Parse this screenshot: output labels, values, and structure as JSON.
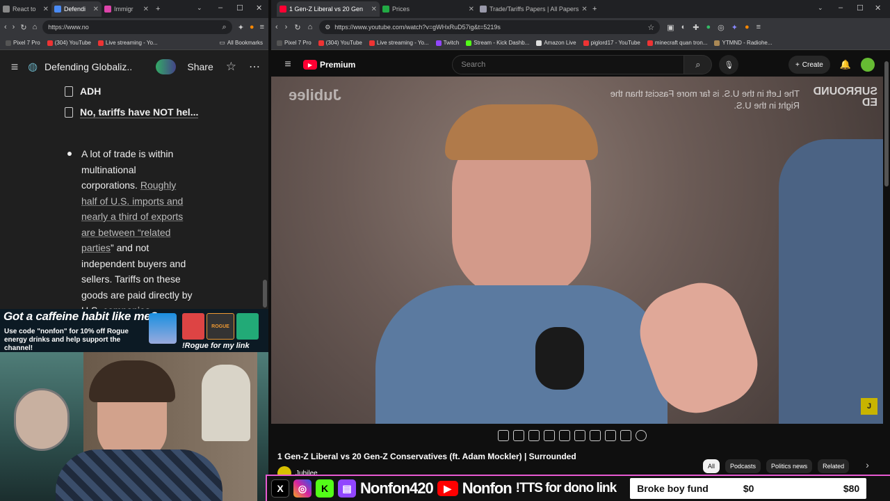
{
  "left_browser": {
    "tabs": [
      {
        "label": "React to",
        "active": false
      },
      {
        "label": "Defendi",
        "active": true
      },
      {
        "label": "Immigr",
        "active": false
      }
    ],
    "url": "https://www.no",
    "bookmarks": [
      "Pixel 7 Pro",
      "(304) YouTube",
      "Live streaming - Yo..."
    ],
    "all_bookmarks": "All Bookmarks"
  },
  "doc": {
    "title": "Defending Globaliz...",
    "share_label": "Share",
    "subpages": [
      "ADH",
      "No, tariffs have NOT hel..."
    ],
    "bullet_plain_1": "A lot of trade is within multinational corporations.",
    "bullet_link": "Roughly half of U.S. imports and nearly a third of exports are between “related parties",
    "bullet_plain_2": "” and not independent buyers and sellers. Tariffs on these goods are paid directly by U.S. companies"
  },
  "promo": {
    "headline": "Got a caffeine habit like me?",
    "subtext": "Use code \"nonfon\" for 10% off Rogue energy drinks and help support the channel!",
    "command": "!Rogue for my link",
    "brand": "ROGUE"
  },
  "right_browser": {
    "tabs": [
      {
        "label": "1 Gen-Z Liberal vs 20 Gen",
        "active": true
      },
      {
        "label": "Prices",
        "active": false
      },
      {
        "label": "Trade/Tariffs Papers | All Papers",
        "active": false
      }
    ],
    "url": "https://www.youtube.com/watch?v=gWHxRuD57ig&t=5219s",
    "bookmarks": [
      "Pixel 7 Pro",
      "(304) YouTube",
      "Live streaming - Yo...",
      "Twitch",
      "Stream - Kick Dashb...",
      "Amazon Live",
      "piglord17 - YouTube",
      "minecraft quan tron...",
      "YTMND - Radiohe..."
    ],
    "all_bookmarks": "All Bookmarks"
  },
  "youtube": {
    "logo_label": "Premium",
    "search_placeholder": "Search",
    "create_label": "Create",
    "video_title": "1 Gen-Z Liberal vs 20 Gen-Z Conservatives (ft. Adam Mockler) | Surrounded",
    "channel_name": "Jubilee",
    "watermark": "Jubilee",
    "overlay_quote": "The Left in the U.S. is far more Fascist than the Right in the U.S.",
    "show_logo": "SURROUNDED",
    "chips": [
      "All",
      "Podcasts",
      "Politics news",
      "Related"
    ]
  },
  "stream_overlay": {
    "handle_1": "Nonfon420",
    "handle_2": "Nonfon",
    "tts": "!TTS for dono link",
    "fund_label": "Broke boy fund",
    "fund_current": "$0",
    "fund_goal": "$80",
    "fund_progress": 0
  },
  "colors": {
    "accent_pink": "#e85ad2",
    "youtube_red": "#ff0033"
  }
}
